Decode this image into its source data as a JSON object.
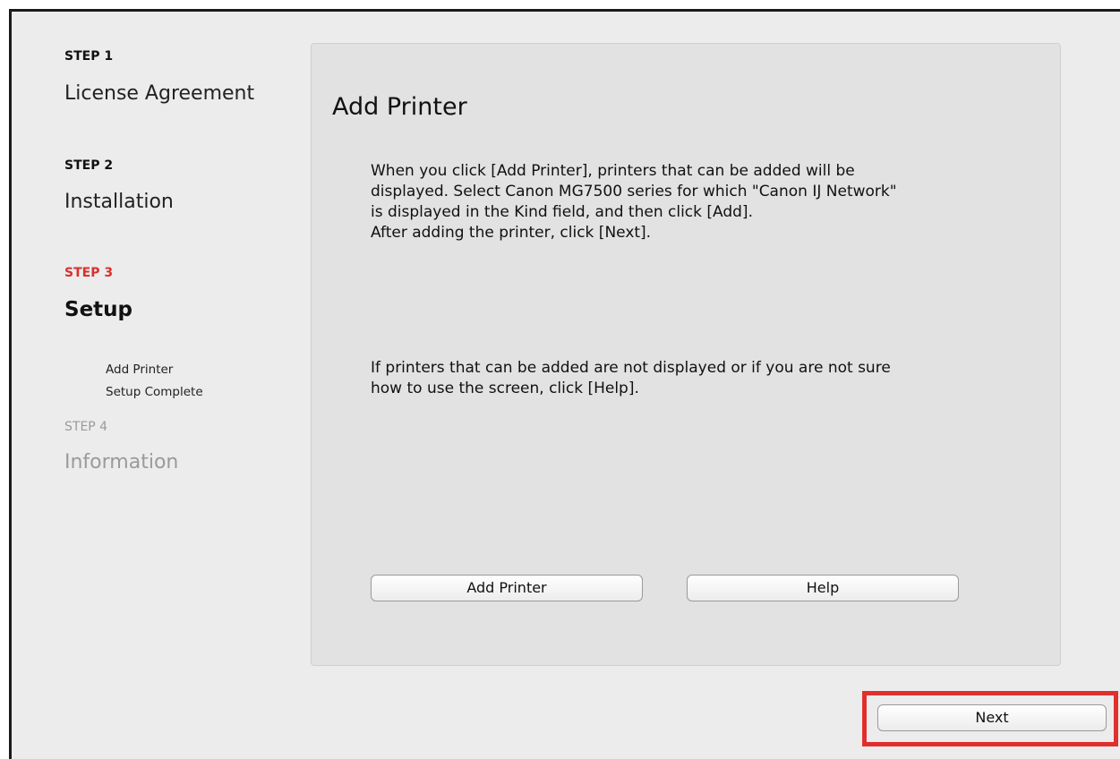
{
  "sidebar": {
    "steps": [
      {
        "label": "STEP 1",
        "title": "License Agreement"
      },
      {
        "label": "STEP 2",
        "title": "Installation"
      },
      {
        "label": "STEP 3",
        "title": "Setup",
        "substeps": [
          "Add Printer",
          "Setup Complete"
        ]
      },
      {
        "label": "STEP 4",
        "title": "Information"
      }
    ],
    "active_color": "#d9302e",
    "disabled_color": "#9a9a9a"
  },
  "main": {
    "title": "Add Printer",
    "instructions": [
      "When you click [Add Printer], printers that can be added will be",
      "displayed. Select Canon MG7500 series for which \"Canon IJ Network\"",
      "is displayed in the Kind field, and then click [Add].",
      "After adding the printer, click [Next]."
    ],
    "help_note": [
      "If printers that can be added are not displayed or if you are not sure",
      "how to use the screen, click [Help]."
    ],
    "add_printer_button": "Add Printer",
    "help_button": "Help"
  },
  "footer": {
    "next_button": "Next",
    "highlight_color": "#e0302e"
  }
}
